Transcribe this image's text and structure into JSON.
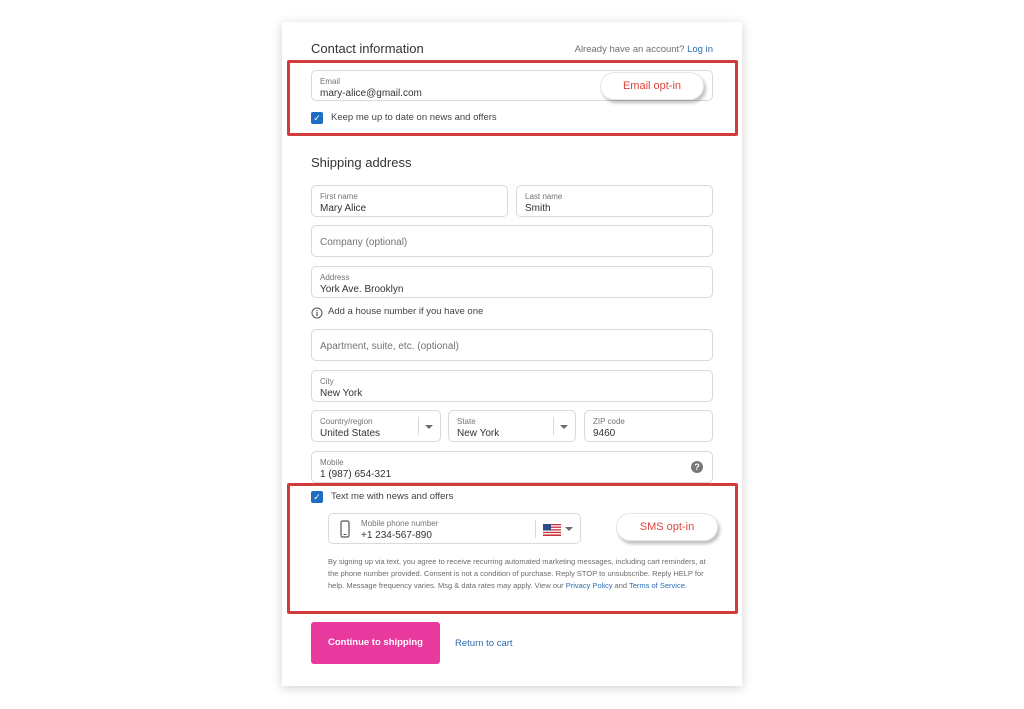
{
  "contact": {
    "title": "Contact information",
    "have_account_text": "Already have an account?",
    "login_link": "Log in",
    "email_label": "Email",
    "email_value": "mary-alice@gmail.com",
    "email_optin_callout": "Email opt-in",
    "news_checkbox_label": "Keep me up to date on news and offers"
  },
  "shipping": {
    "title": "Shipping address",
    "first_name_label": "First name",
    "first_name_value": "Mary Alice",
    "last_name_label": "Last name",
    "last_name_value": "Smith",
    "company_placeholder": "Company (optional)",
    "address_label": "Address",
    "address_value": "York Ave. Brooklyn",
    "address_hint": "Add a house number if you have one",
    "apartment_placeholder": "Apartment, suite, etc. (optional)",
    "city_label": "City",
    "city_value": "New York",
    "country_label": "Country/region",
    "country_value": "United States",
    "state_label": "State",
    "state_value": "New York",
    "zip_label": "ZIP code",
    "zip_value": "9460",
    "mobile_label": "Mobile",
    "mobile_value": "1 (987) 654-321"
  },
  "sms": {
    "checkbox_label": "Text me with news and offers",
    "phone_label": "Mobile phone number",
    "phone_value": "+1 234-567-890",
    "sms_optin_callout": "SMS opt-in",
    "disclaimer_text": "By signing up via text, you agree to receive recurring automated marketing messages, including cart reminders, at the phone number provided. Consent is not a condition of purchase. Reply STOP to unsubscribe. Reply HELP for help. Message frequency varies. Msg & data rates may apply. View our",
    "privacy_link": "Privacy Policy",
    "and_text": "and",
    "terms_link": "Terms of Service",
    "period": "."
  },
  "footer": {
    "continue_button": "Continue to shipping",
    "return_link": "Return to cart"
  },
  "icons": {
    "info": "info-icon",
    "help": "question-icon",
    "phone": "phone-icon",
    "flag": "us-flag-icon"
  },
  "colors": {
    "primary_button": "#e8399e",
    "checkbox": "#1f6dc0",
    "highlight_box": "#d23b3b",
    "link": "#2b6cb5"
  }
}
